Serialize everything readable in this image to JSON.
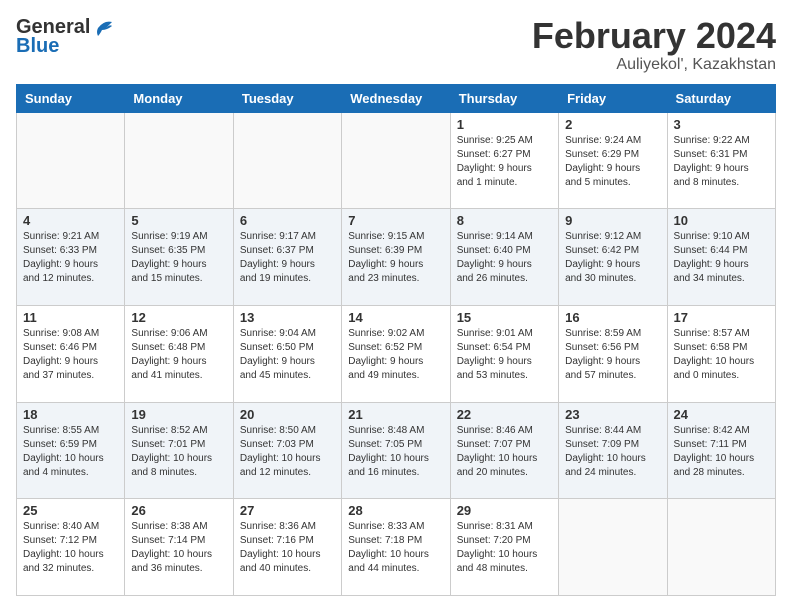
{
  "header": {
    "logo_general": "General",
    "logo_blue": "Blue",
    "month_year": "February 2024",
    "location": "Auliyekol', Kazakhstan"
  },
  "weekdays": [
    "Sunday",
    "Monday",
    "Tuesday",
    "Wednesday",
    "Thursday",
    "Friday",
    "Saturday"
  ],
  "weeks": [
    [
      {
        "day": "",
        "info": ""
      },
      {
        "day": "",
        "info": ""
      },
      {
        "day": "",
        "info": ""
      },
      {
        "day": "",
        "info": ""
      },
      {
        "day": "1",
        "info": "Sunrise: 9:25 AM\nSunset: 6:27 PM\nDaylight: 9 hours\nand 1 minute."
      },
      {
        "day": "2",
        "info": "Sunrise: 9:24 AM\nSunset: 6:29 PM\nDaylight: 9 hours\nand 5 minutes."
      },
      {
        "day": "3",
        "info": "Sunrise: 9:22 AM\nSunset: 6:31 PM\nDaylight: 9 hours\nand 8 minutes."
      }
    ],
    [
      {
        "day": "4",
        "info": "Sunrise: 9:21 AM\nSunset: 6:33 PM\nDaylight: 9 hours\nand 12 minutes."
      },
      {
        "day": "5",
        "info": "Sunrise: 9:19 AM\nSunset: 6:35 PM\nDaylight: 9 hours\nand 15 minutes."
      },
      {
        "day": "6",
        "info": "Sunrise: 9:17 AM\nSunset: 6:37 PM\nDaylight: 9 hours\nand 19 minutes."
      },
      {
        "day": "7",
        "info": "Sunrise: 9:15 AM\nSunset: 6:39 PM\nDaylight: 9 hours\nand 23 minutes."
      },
      {
        "day": "8",
        "info": "Sunrise: 9:14 AM\nSunset: 6:40 PM\nDaylight: 9 hours\nand 26 minutes."
      },
      {
        "day": "9",
        "info": "Sunrise: 9:12 AM\nSunset: 6:42 PM\nDaylight: 9 hours\nand 30 minutes."
      },
      {
        "day": "10",
        "info": "Sunrise: 9:10 AM\nSunset: 6:44 PM\nDaylight: 9 hours\nand 34 minutes."
      }
    ],
    [
      {
        "day": "11",
        "info": "Sunrise: 9:08 AM\nSunset: 6:46 PM\nDaylight: 9 hours\nand 37 minutes."
      },
      {
        "day": "12",
        "info": "Sunrise: 9:06 AM\nSunset: 6:48 PM\nDaylight: 9 hours\nand 41 minutes."
      },
      {
        "day": "13",
        "info": "Sunrise: 9:04 AM\nSunset: 6:50 PM\nDaylight: 9 hours\nand 45 minutes."
      },
      {
        "day": "14",
        "info": "Sunrise: 9:02 AM\nSunset: 6:52 PM\nDaylight: 9 hours\nand 49 minutes."
      },
      {
        "day": "15",
        "info": "Sunrise: 9:01 AM\nSunset: 6:54 PM\nDaylight: 9 hours\nand 53 minutes."
      },
      {
        "day": "16",
        "info": "Sunrise: 8:59 AM\nSunset: 6:56 PM\nDaylight: 9 hours\nand 57 minutes."
      },
      {
        "day": "17",
        "info": "Sunrise: 8:57 AM\nSunset: 6:58 PM\nDaylight: 10 hours\nand 0 minutes."
      }
    ],
    [
      {
        "day": "18",
        "info": "Sunrise: 8:55 AM\nSunset: 6:59 PM\nDaylight: 10 hours\nand 4 minutes."
      },
      {
        "day": "19",
        "info": "Sunrise: 8:52 AM\nSunset: 7:01 PM\nDaylight: 10 hours\nand 8 minutes."
      },
      {
        "day": "20",
        "info": "Sunrise: 8:50 AM\nSunset: 7:03 PM\nDaylight: 10 hours\nand 12 minutes."
      },
      {
        "day": "21",
        "info": "Sunrise: 8:48 AM\nSunset: 7:05 PM\nDaylight: 10 hours\nand 16 minutes."
      },
      {
        "day": "22",
        "info": "Sunrise: 8:46 AM\nSunset: 7:07 PM\nDaylight: 10 hours\nand 20 minutes."
      },
      {
        "day": "23",
        "info": "Sunrise: 8:44 AM\nSunset: 7:09 PM\nDaylight: 10 hours\nand 24 minutes."
      },
      {
        "day": "24",
        "info": "Sunrise: 8:42 AM\nSunset: 7:11 PM\nDaylight: 10 hours\nand 28 minutes."
      }
    ],
    [
      {
        "day": "25",
        "info": "Sunrise: 8:40 AM\nSunset: 7:12 PM\nDaylight: 10 hours\nand 32 minutes."
      },
      {
        "day": "26",
        "info": "Sunrise: 8:38 AM\nSunset: 7:14 PM\nDaylight: 10 hours\nand 36 minutes."
      },
      {
        "day": "27",
        "info": "Sunrise: 8:36 AM\nSunset: 7:16 PM\nDaylight: 10 hours\nand 40 minutes."
      },
      {
        "day": "28",
        "info": "Sunrise: 8:33 AM\nSunset: 7:18 PM\nDaylight: 10 hours\nand 44 minutes."
      },
      {
        "day": "29",
        "info": "Sunrise: 8:31 AM\nSunset: 7:20 PM\nDaylight: 10 hours\nand 48 minutes."
      },
      {
        "day": "",
        "info": ""
      },
      {
        "day": "",
        "info": ""
      }
    ]
  ]
}
